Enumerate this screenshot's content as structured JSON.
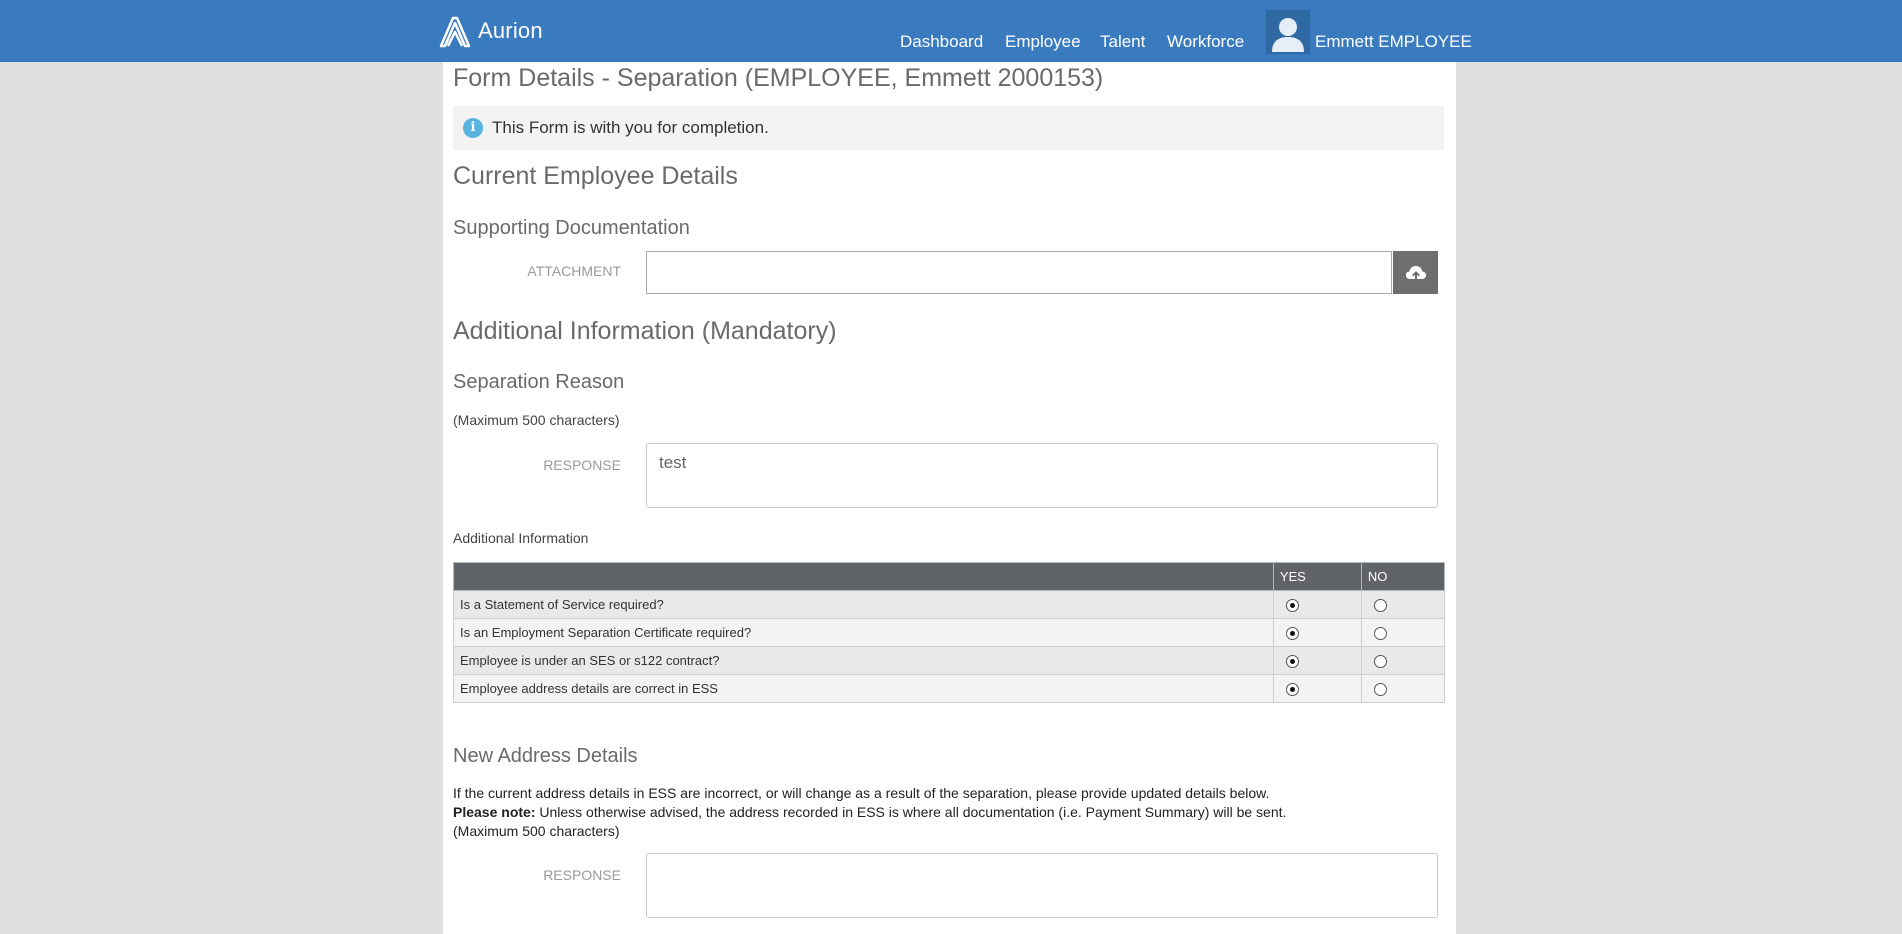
{
  "header": {
    "logo_text": "Aurion",
    "nav": [
      "Dashboard",
      "Employee",
      "Talent",
      "Workforce"
    ],
    "user_name": "Emmett EMPLOYEE",
    "bar_color": "#3a7bbf"
  },
  "form": {
    "title": "Form Details - Separation (EMPLOYEE, Emmett 2000153)",
    "info_message": "This Form is with you for completion.",
    "section_current": "Current Employee Details",
    "supporting_documentation": "Supporting Documentation",
    "attachment_label": "ATTACHMENT",
    "attachment_value": "",
    "section_additional": "Additional Information (Mandatory)",
    "separation_reason": {
      "heading": "Separation Reason",
      "max_note": "(Maximum 500 characters)",
      "response_label": "RESPONSE",
      "response_value": "test"
    },
    "additional_info": {
      "label": "Additional Information",
      "col_yes": "YES",
      "col_no": "NO",
      "rows": [
        {
          "question": "Is a Statement of Service required?",
          "answer": "YES"
        },
        {
          "question": "Is an Employment Separation Certificate required?",
          "answer": "YES"
        },
        {
          "question": "Employee is under an SES or s122 contract?",
          "answer": "YES"
        },
        {
          "question": "Employee address details are correct in ESS",
          "answer": "YES"
        }
      ]
    },
    "new_address": {
      "heading": "New Address Details",
      "line1": "If the current address details in ESS are incorrect, or will change as a result of the separation, please provide updated details below.",
      "please_note_bold": "Please note:",
      "please_note_text": " Unless otherwise advised, the address recorded in ESS is where all documentation (i.e. Payment Summary) will be sent.",
      "max_note": "(Maximum 500 characters)",
      "response_label": "RESPONSE",
      "response_value": ""
    }
  }
}
